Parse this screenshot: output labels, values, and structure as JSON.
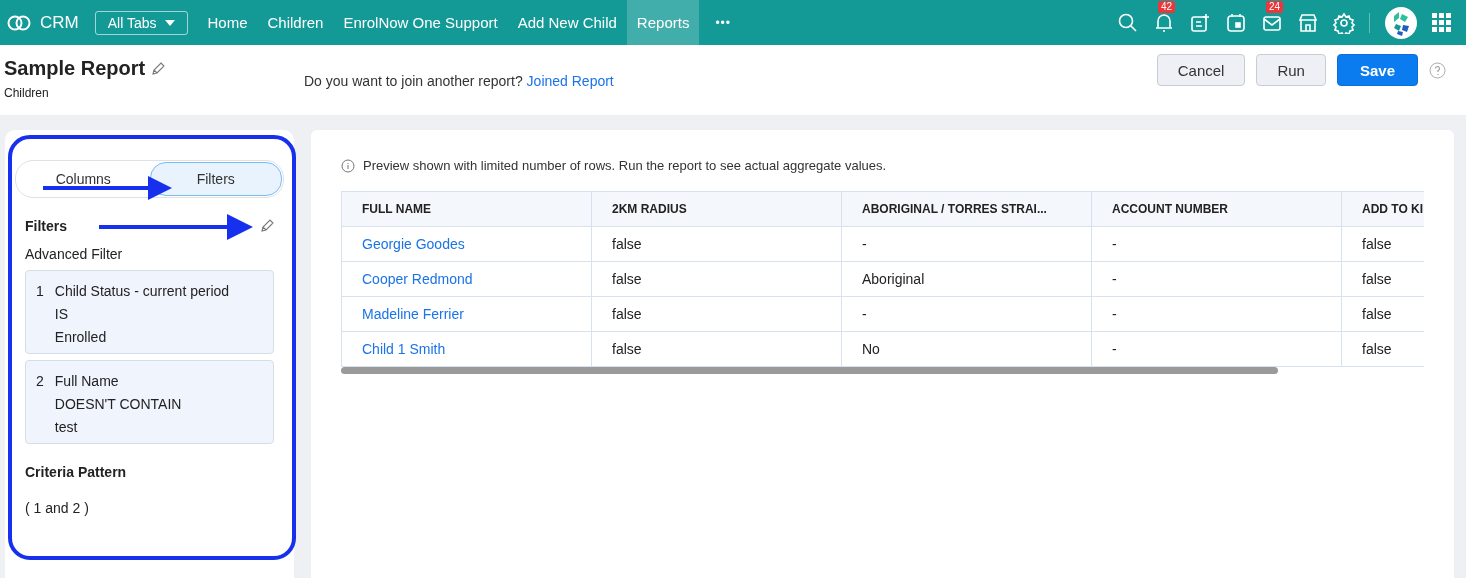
{
  "nav": {
    "logo": "CRM",
    "all_tabs": "All Tabs",
    "tabs": [
      {
        "label": "Home",
        "selected": false
      },
      {
        "label": "Children",
        "selected": false
      },
      {
        "label": "EnrolNow One Support",
        "selected": false
      },
      {
        "label": "Add New Child",
        "selected": false
      },
      {
        "label": "Reports",
        "selected": true
      }
    ],
    "more": "•••",
    "icons": [
      {
        "kind": "search"
      },
      {
        "kind": "bell",
        "badge": "42"
      },
      {
        "kind": "note"
      },
      {
        "kind": "calendar"
      },
      {
        "kind": "mail",
        "badge": "24"
      },
      {
        "kind": "store"
      },
      {
        "kind": "settings"
      }
    ]
  },
  "header": {
    "title": "Sample Report",
    "subtitle": "Children",
    "prompt": "Do you want to join another report?",
    "link": "Joined Report",
    "buttons": [
      {
        "label": "Cancel",
        "kind": "secondary"
      },
      {
        "label": "Run",
        "kind": "secondary"
      },
      {
        "label": "Save",
        "kind": "primary"
      }
    ]
  },
  "panel": {
    "tabs": [
      {
        "label": "Columns",
        "selected": false
      },
      {
        "label": "Filters",
        "selected": true
      }
    ],
    "heading": "Filters",
    "subheading": "Advanced Filter",
    "filters": [
      {
        "number": "1",
        "field": "Child Status - current period",
        "operator": "IS",
        "value": "Enrolled"
      },
      {
        "number": "2",
        "field": "Full Name",
        "operator": "DOESN'T CONTAIN",
        "value": "test"
      }
    ],
    "criteria_label": "Criteria Pattern",
    "criteria_pattern": "( 1 and 2 )"
  },
  "preview": {
    "note": "Preview shown with limited number of rows. Run the report to see actual aggregate values.",
    "table": {
      "columns": [
        "FULL NAME",
        "2KM RADIUS",
        "ABORIGINAL / TORRES STRAI...",
        "ACCOUNT NUMBER",
        "ADD TO KI"
      ],
      "rows": [
        [
          "Georgie Goodes",
          "false",
          "-",
          "-",
          "false"
        ],
        [
          "Cooper Redmond",
          "false",
          "Aboriginal",
          "-",
          "false"
        ],
        [
          "Madeline Ferrier",
          "false",
          "-",
          "-",
          "false"
        ],
        [
          "Child 1 Smith",
          "false",
          "No",
          "-",
          "false"
        ]
      ]
    }
  }
}
